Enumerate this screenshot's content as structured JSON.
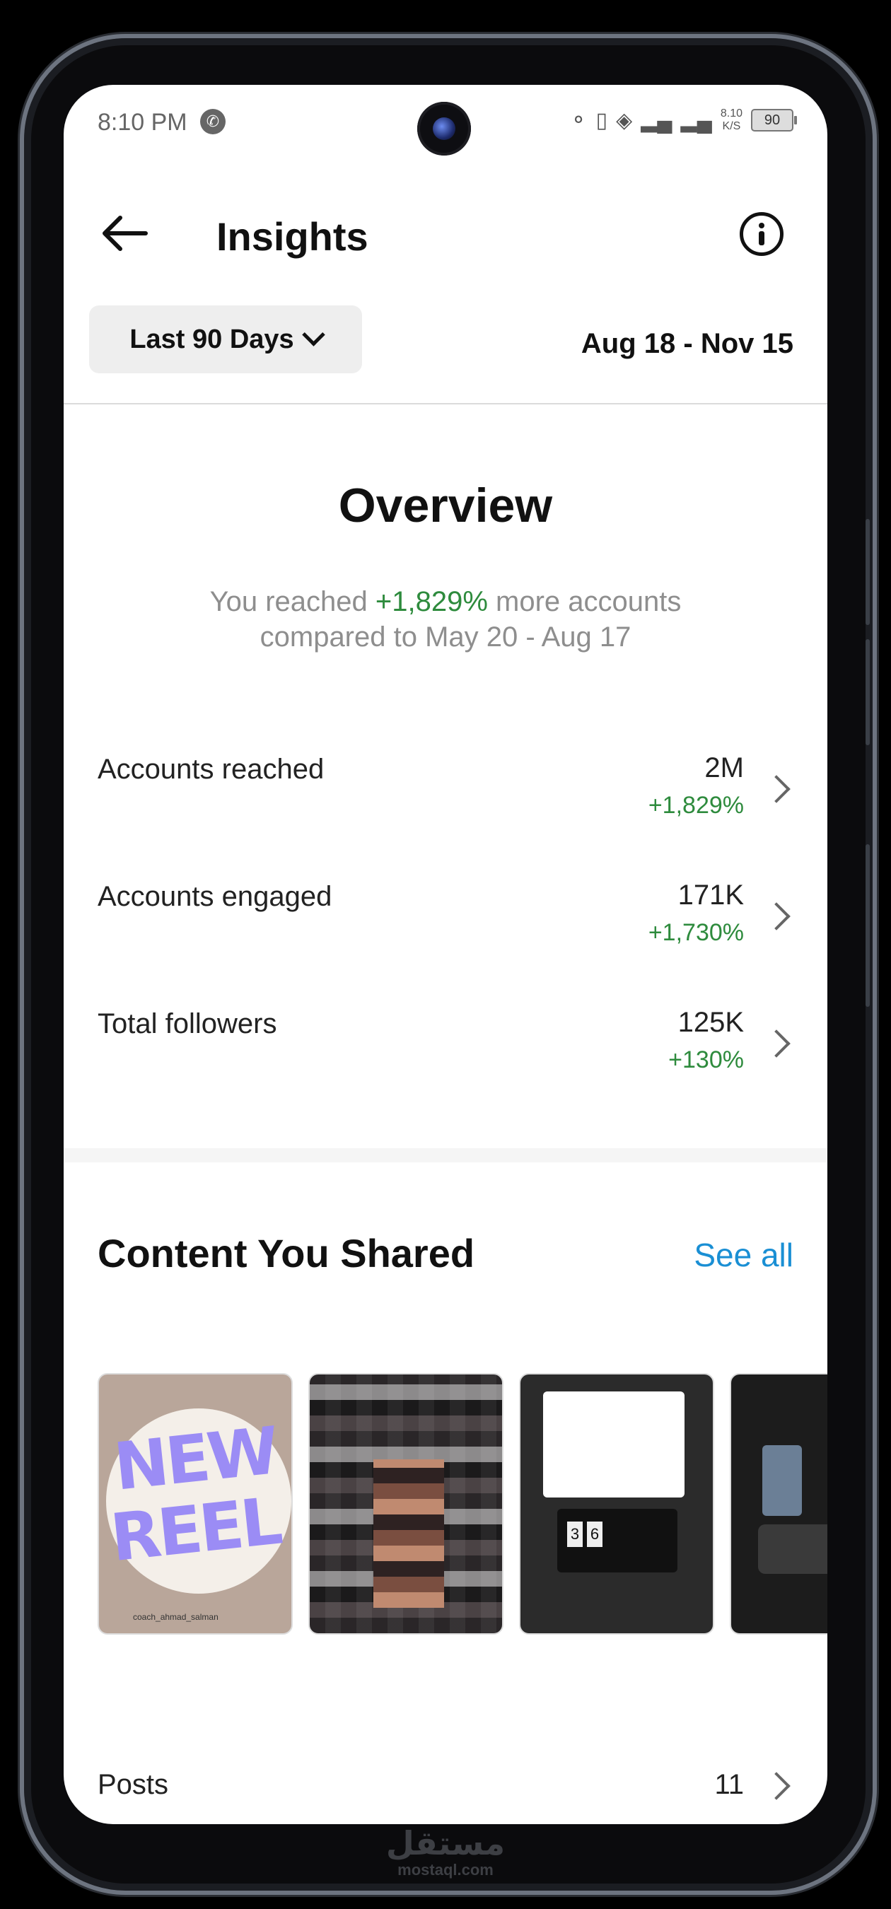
{
  "status_bar": {
    "time": "8:10 PM",
    "net_speed_value": "8.10",
    "net_speed_unit": "K/S",
    "battery": "90"
  },
  "header": {
    "title": "Insights"
  },
  "range": {
    "selected": "Last 90 Days",
    "dates": "Aug 18 - Nov 15"
  },
  "overview": {
    "title": "Overview",
    "summary_prefix": "You reached ",
    "summary_change": "+1,829%",
    "summary_suffix": " more accounts",
    "summary_line2": "compared to May 20 - Aug 17"
  },
  "metrics": [
    {
      "label": "Accounts reached",
      "value": "2M",
      "change": "+1,829%"
    },
    {
      "label": "Accounts engaged",
      "value": "171K",
      "change": "+1,730%"
    },
    {
      "label": "Total followers",
      "value": "125K",
      "change": "+130%"
    }
  ],
  "content": {
    "title": "Content You Shared",
    "see_all": "See all",
    "thumb1_line1": "NEW",
    "thumb1_line2": "REEL",
    "thumb1_handle": "coach_ahmad_salman",
    "thumb3_digits": [
      "3",
      "6"
    ]
  },
  "posts": {
    "label": "Posts",
    "value": "11"
  },
  "watermark": {
    "arabic": "مستقل",
    "latin": "mostaql.com"
  }
}
